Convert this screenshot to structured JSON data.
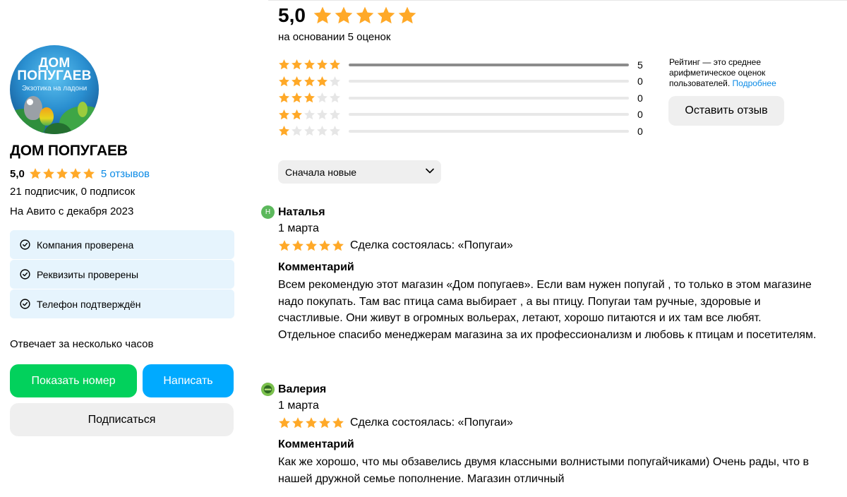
{
  "colors": {
    "star_filled": "#ffa928",
    "star_empty": "#e6e6e6",
    "green": "#02d15c",
    "blue": "#00aaff",
    "link": "#0a8ae6"
  },
  "seller": {
    "logo_line1": "ДОМ",
    "logo_line2": "ПОПУГАЕВ",
    "logo_tagline": "Экзотика на ладони",
    "name": "ДОМ ПОПУГАЕВ",
    "rating": "5,0",
    "rating_stars": 5,
    "reviews_link": "5 отзывов",
    "subscribers": "21 подписчик, 0 подписок",
    "since": "На Авито с декабря 2023",
    "checks": [
      {
        "icon": "check-circle-icon",
        "label": "Компания проверена"
      },
      {
        "icon": "check-circle-icon",
        "label": "Реквизиты проверены"
      },
      {
        "icon": "check-circle-icon",
        "label": "Телефон подтверждён"
      }
    ],
    "responds": "Отвечает за несколько часов",
    "show_number": "Показать номер",
    "write": "Написать",
    "subscribe": "Подписаться"
  },
  "summary": {
    "average": "5,0",
    "average_stars": 5,
    "based_on": "на основании 5 оценок",
    "distribution": [
      {
        "stars": 5,
        "count": "5",
        "fraction": 1.0
      },
      {
        "stars": 4,
        "count": "0",
        "fraction": 0
      },
      {
        "stars": 3,
        "count": "0",
        "fraction": 0
      },
      {
        "stars": 2,
        "count": "0",
        "fraction": 0
      },
      {
        "stars": 1,
        "count": "0",
        "fraction": 0
      }
    ],
    "note_text": "Рейтинг — это среднее арифметическое оценок пользователей.",
    "note_link": "Подробнее",
    "leave_review": "Оставить отзыв",
    "sort_value": "Сначала новые"
  },
  "reviews": [
    {
      "avatar_letter": "Н",
      "avatar_color": "#5cb85c",
      "name": "Наталья",
      "date": "1 марта",
      "stars": 5,
      "deal": "Сделка состоялась: «Попугаи»",
      "comment_title": "Комментарий",
      "comment": "Всем рекомендую этот магазин «Дом попугаев». Если вам нужен попугай , то только в этом магазине надо покупать. Там вас птица сама выбирает , а вы птицу. Попугаи там ручные, здоровые и счастливые. Они живут в огромных вольерах, летают, хорошо питаются и их там все любят. Отдельное спасибо менеджерам магазина за их профессионализм и любовь к птицам и посетителям."
    },
    {
      "avatar_letter": "",
      "avatar_color": "#6ab04c",
      "name": "Валерия",
      "date": "1 марта",
      "stars": 5,
      "deal": "Сделка состоялась: «Попугаи»",
      "comment_title": "Комментарий",
      "comment": "Как же хорошо, что мы обзавелись двумя классными волнистыми попугайчиками) Очень рады, что в нашей дружной семье пополнение. Магазин отличный"
    }
  ]
}
